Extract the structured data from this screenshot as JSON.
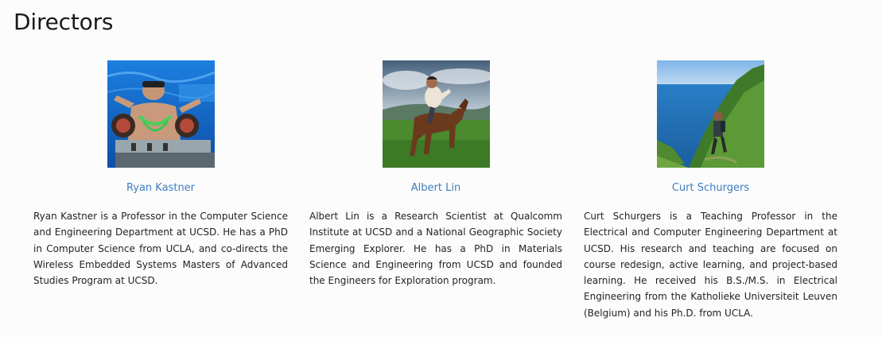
{
  "page": {
    "title": "Directors"
  },
  "directors": [
    {
      "name": "Ryan Kastner",
      "bio": "Ryan Kastner is a Professor in the Computer Science and Engineering Department at UCSD. He has a PhD in Computer Science from UCLA, and co-directs the Wireless Embedded Systems Masters of Advanced Studies Program at UCSD."
    },
    {
      "name": "Albert Lin",
      "bio": "Albert Lin is a Research Scientist at Qualcomm Institute at UCSD and a National Geographic Society Emerging Explorer. He has a PhD in Materials Science and Engineering from UCSD and founded the Engineers for Exploration program."
    },
    {
      "name": "Curt Schurgers",
      "bio": "Curt Schurgers is a Teaching Professor in the Electrical and Computer Engineering Department at UCSD. His research and teaching are focused on course redesign, active learning, and project-based learning. He received his B.S./M.S. in Electrical Engineering from the Katholieke Universiteit Leuven (Belgium) and his Ph.D. from UCLA."
    }
  ]
}
